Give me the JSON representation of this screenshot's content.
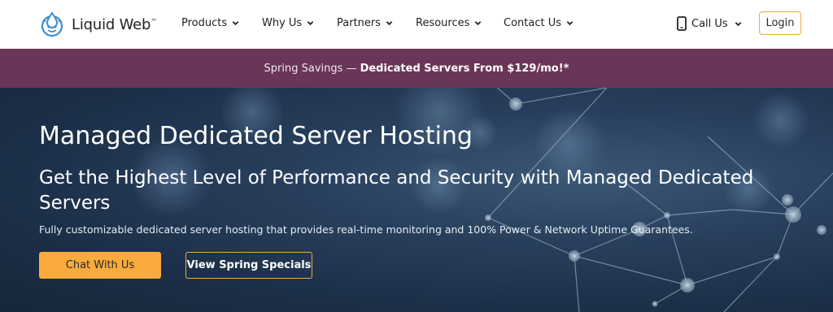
{
  "brand": {
    "name": "Liquid Web",
    "tm": "™",
    "logo_icon": "liquid-web-logo-icon"
  },
  "nav": {
    "items": [
      {
        "label": "Products",
        "icon": "chevron-down-icon"
      },
      {
        "label": "Why Us",
        "icon": "chevron-down-icon"
      },
      {
        "label": "Partners",
        "icon": "chevron-down-icon"
      },
      {
        "label": "Resources",
        "icon": "chevron-down-icon"
      },
      {
        "label": "Contact Us",
        "icon": "chevron-down-icon"
      }
    ],
    "call_us": {
      "label": "Call Us",
      "icon": "phone-icon"
    },
    "login_label": "Login"
  },
  "promo": {
    "prefix": "Spring Savings —",
    "highlight": "Dedicated Servers From $129/mo!*"
  },
  "hero": {
    "title": "Managed Dedicated Server Hosting",
    "subtitle": "Get the Highest Level of Performance and Security with Managed Dedicated Servers",
    "description": "Fully customizable dedicated server hosting that provides real-time monitoring and 100% Power & Network Uptime Guarantees.",
    "primary_cta": "Chat With Us",
    "secondary_cta": "View Spring Specials"
  },
  "colors": {
    "accent": "#f9ab3e",
    "promo_bg": "#6a3657",
    "hero_bg": "#1c2f48",
    "logo_blue": "#3a8fd0"
  }
}
